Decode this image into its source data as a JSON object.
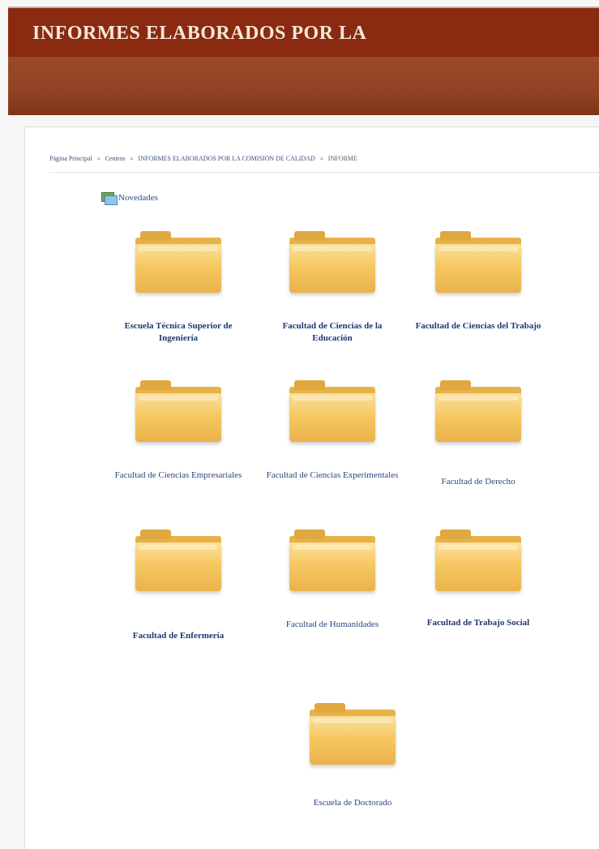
{
  "header": {
    "title": "INFORMES ELABORADOS POR LA"
  },
  "breadcrumb": [
    "Página Principal",
    "Centros",
    "INFORMES ELABORADOS POR LA COMISIÓN DE CALIDAD",
    "INFORME"
  ],
  "novedades": {
    "label": "Novedades",
    "icon": "news-icon"
  },
  "folders": [
    {
      "label": "Escuela Técnica Superior de Ingeniería"
    },
    {
      "label": "Facultad de Ciencias de la Educación"
    },
    {
      "label": "Facultad de Ciencias del Trabajo"
    },
    {
      "label": "Facultad de Ciencias Empresariales"
    },
    {
      "label": "Facultad de Ciencias Experimentales"
    },
    {
      "label": "Facultad de Derecho"
    },
    {
      "label": "Facultad de Enfermería"
    },
    {
      "label": "Facultad de Humanidades"
    },
    {
      "label": "Facultad de Trabajo Social"
    },
    {
      "label": "Escuela de Doctorado"
    }
  ],
  "colors": {
    "header_bg": "#8a2a10",
    "band_bg": "#914224",
    "folder": "#f5c862",
    "link": "#1f3870"
  }
}
